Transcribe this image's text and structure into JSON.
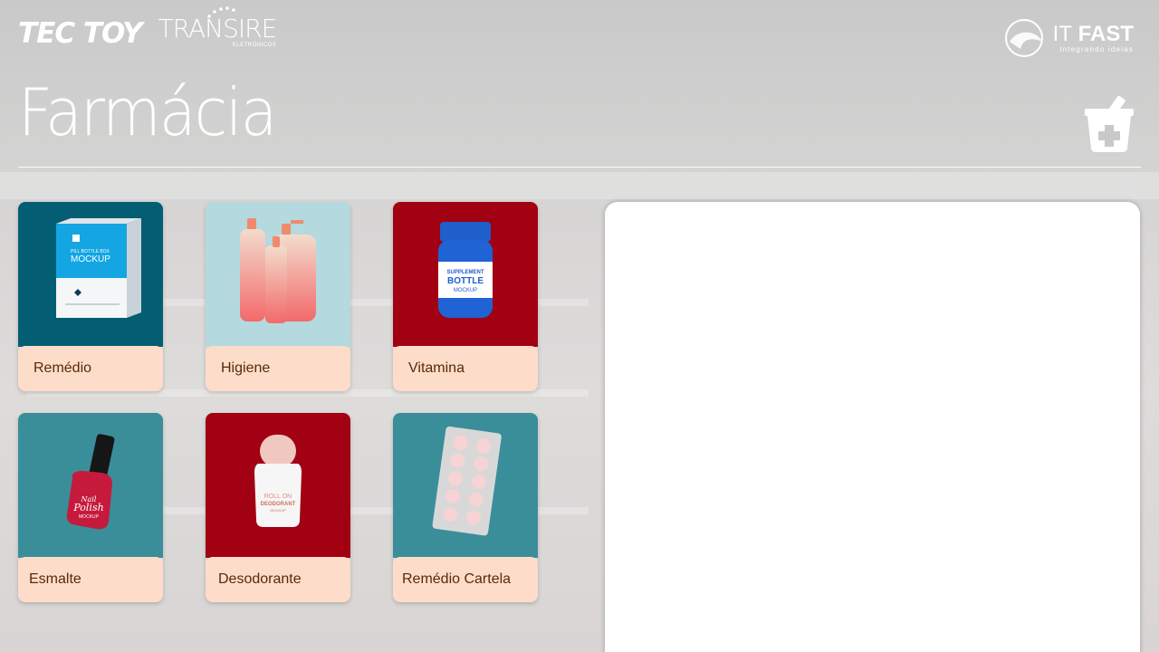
{
  "header": {
    "brand_left_1": "TEC TOY",
    "brand_left_2": "TRANSIRE",
    "brand_left_2_sub": "ELETRÔNICOS",
    "brand_right": {
      "prefix": "IT",
      "name": "FAST",
      "tagline": "Integrando ideias"
    }
  },
  "page": {
    "title": "Farmácia",
    "icon": "mortar-pestle-plus-icon"
  },
  "products": [
    {
      "label": "Remédio",
      "bg": "#035e74",
      "image": "medicine-box-mockup"
    },
    {
      "label": "Higiene",
      "bg": "#b4d9df",
      "image": "hygiene-bottles"
    },
    {
      "label": "Vitamina",
      "bg": "#a10113",
      "image": "supplement-bottle"
    },
    {
      "label": "Esmalte",
      "bg": "#3a8e9a",
      "image": "nail-polish-bottle"
    },
    {
      "label": "Desodorante",
      "bg": "#a10113",
      "image": "roll-on-deodorant"
    },
    {
      "label": "Remédio Cartela",
      "bg": "#3a8e9a",
      "image": "pill-blister-pack"
    }
  ],
  "mockup_text": {
    "box_line1": "PILL BOTTLE BOX",
    "box_line2": "MOCKUP",
    "bottle_line1": "SUPPLEMENT",
    "bottle_line2": "BOTTLE",
    "bottle_line3": "MOCKUP",
    "polish_line1": "Nail",
    "polish_line2": "Polish",
    "polish_line3": "MOCKUP",
    "deo_line1": "ROLL ON",
    "deo_line2": "DEODORANT",
    "deo_line3": "MOCKUP"
  }
}
